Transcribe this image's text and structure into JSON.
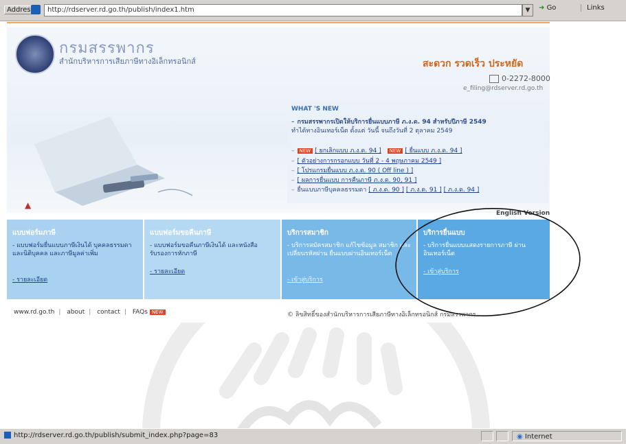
{
  "browser": {
    "address_label": "Address",
    "url": "http://rdserver.rd.go.th/publish/index1.htm",
    "go_label": "Go",
    "links_label": "Links",
    "status_url": "http://rdserver.rd.go.th/publish/submit_index.php?page=83",
    "zone_label": "Internet"
  },
  "site": {
    "brand": "กรมสรรพากร",
    "brand_sub": "สำนักบริหารการเสียภาษีทางอิเล็กทรอนิกส์",
    "slogan": "สะดวก รวดเร็ว ประหยัด",
    "phone": "0-2272-8000",
    "email": "e_filing@rdserver.rd.go.th"
  },
  "whats_new": {
    "title": "WHAT 'S NEW",
    "headline1": "กรมสรรพากรเปิดให้บริการยื่นแบบภาษี ภ.ง.ด. 94 สำหรับปีภาษี 2549",
    "headline2": "ทำได้ทางอินเทอร์เน็ต ตั้งแต่ วันนี้ จนถึงวันที่ 2 ตุลาคม 2549",
    "new_badge": "NEW",
    "links": {
      "l1": "[ ยกเลิกแบบ ภ.ง.ด. 94 ]",
      "l2": "[ ยื่นแบบ ภ.ง.ด. 94 ]",
      "l3": "[ ตัวอย่างการกรอกแบบ วันที่ 2 - 4 พฤษภาคม 2549 ]",
      "l4": "[ โปรแกรมยื่นแบบ ภ.ง.ด. 90 ( Off line ) ]",
      "l5": "[ ผลการยื่นแบบ การคืนภาษี ภ.ง.ด. 90, 91 ]",
      "l6_prefix": "ยื่นแบบภาษีบุคคลธรรมดา",
      "l6a": "[ ภ.ง.ด. 90 ]",
      "l6b": "[ ภ.ง.ด. 91 ]",
      "l6c": "[ ภ.ง.ด. 94 ]"
    },
    "english_version": "English Version"
  },
  "categories": [
    {
      "title": "แบบฟอร์มภาษี",
      "desc": "- แบบฟอร์มยื่นแบบภาษีเงินได้ บุคคลธรรมดาและนิติบุคคล และภาษีมูลค่าเพิ่ม",
      "more": "- รายละเอียด"
    },
    {
      "title": "แบบฟอร์มขอคืนภาษี",
      "desc": "- แบบฟอร์มขอคืนภาษีเงินได้ และหนังสือรับรองการหักภาษี",
      "more": "- รายละเอียด"
    },
    {
      "title": "บริการสมาชิก",
      "desc": "- บริการสมัครสมาชิก แก้ไขข้อมูล สมาชิก และเปลี่ยนรหัสผ่าน ยื่นแบบผ่านอินเทอร์เน็ต",
      "more": "- เข้าสู่บริการ"
    },
    {
      "title": "บริการยื่นแบบ",
      "desc": "- บริการยื่นแบบแสดงรายการภาษี ผ่านอินเทอร์เน็ต",
      "more": "- เข้าสู่บริการ"
    }
  ],
  "footer": {
    "site": "www.rd.go.th",
    "about": "about",
    "contact": "contact",
    "faqs": "FAQs",
    "new_badge": "NEW",
    "copyright": "© ลิขสิทธิ์ของสำนักบริหารการเสียภาษีทางอิเล็กทรอนิกส์ กรมสรรพากร"
  },
  "colors": {
    "accent_orange": "#d2661b",
    "cat1": "#a9d1f0",
    "cat2": "#b5d9f3",
    "cat3": "#79b9e8",
    "cat4": "#5aa9e3"
  }
}
